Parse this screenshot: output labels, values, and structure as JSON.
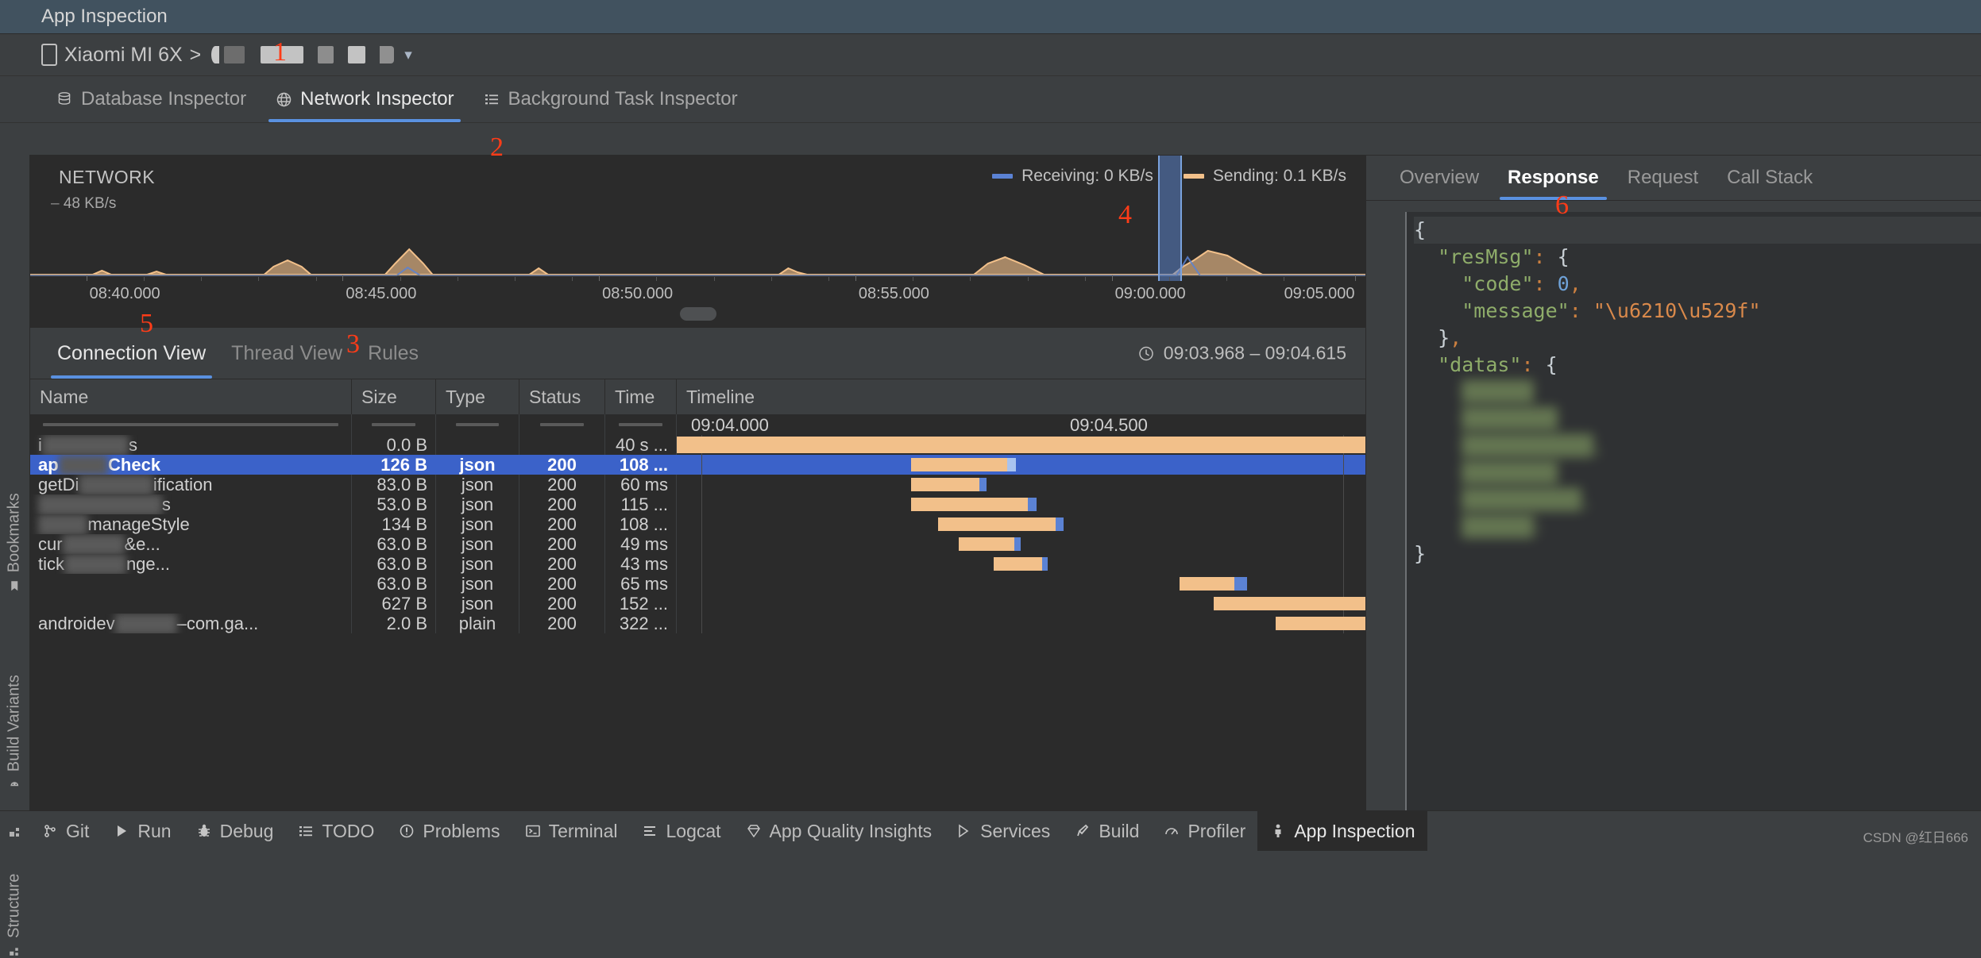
{
  "window": {
    "title": "App Inspection"
  },
  "device_bar": {
    "device": "Xiaomi MI 6X",
    "separator": ">",
    "process_redacted": "█████████",
    "dropdown_icon": "chevron-down-icon",
    "annotation": "1"
  },
  "inspector_tabs": [
    {
      "label": "Database Inspector",
      "icon": "database-icon",
      "selected": false
    },
    {
      "label": "Network Inspector",
      "icon": "globe-icon",
      "selected": true,
      "annotation": "2"
    },
    {
      "label": "Background Task Inspector",
      "icon": "list-icon",
      "selected": false
    }
  ],
  "network_graph": {
    "title": "NETWORK",
    "y_axis_label": "48 KB/s",
    "legend": [
      {
        "label": "Receiving: 0 KB/s",
        "color": "#5b82d4"
      },
      {
        "label": "Sending: 0.1 KB/s",
        "color": "#f2c08a"
      }
    ],
    "annotation": "4",
    "x_ticks": [
      "08:40.000",
      "08:45.000",
      "08:50.000",
      "08:55.000",
      "09:00.000",
      "09:05.000"
    ]
  },
  "connection_tabs": [
    {
      "label": "Connection View",
      "selected": true,
      "annotation": "5"
    },
    {
      "label": "Thread View",
      "selected": false
    },
    {
      "label": "Rules",
      "selected": false,
      "annotation": "3"
    }
  ],
  "time_range": {
    "icon": "clock-icon",
    "text": "09:03.968 – 09:04.615"
  },
  "table": {
    "columns": [
      "Name",
      "Size",
      "Type",
      "Status",
      "Time",
      "Timeline"
    ],
    "timeline_ticks": [
      "09:04.000",
      "09:04.500"
    ],
    "rows": [
      {
        "name": "i███████s",
        "size": "0.0 B",
        "type": "",
        "status": "",
        "time": "40 s ...",
        "selected": false
      },
      {
        "name": "ap████Check",
        "size": "126 B",
        "type": "json",
        "status": "200",
        "time": "108 ...",
        "selected": true
      },
      {
        "name": "getDi██████ification",
        "size": "83.0 B",
        "type": "json",
        "status": "200",
        "time": "60 ms",
        "selected": false
      },
      {
        "name": "██████████s",
        "size": "53.0 B",
        "type": "json",
        "status": "200",
        "time": "115 ...",
        "selected": false
      },
      {
        "name": "████manageStyle",
        "size": "134 B",
        "type": "json",
        "status": "200",
        "time": "108 ...",
        "selected": false
      },
      {
        "name": "cur█████&e...",
        "size": "63.0 B",
        "type": "json",
        "status": "200",
        "time": "49 ms",
        "selected": false
      },
      {
        "name": "tick█████nge...",
        "size": "63.0 B",
        "type": "json",
        "status": "200",
        "time": "43 ms",
        "selected": false
      },
      {
        "name": "",
        "size": "63.0 B",
        "type": "json",
        "status": "200",
        "time": "65 ms",
        "selected": false
      },
      {
        "name": "",
        "size": "627 B",
        "type": "json",
        "status": "200",
        "time": "152 ...",
        "selected": false
      },
      {
        "name": "androidev█████–com.ga...",
        "size": "2.0 B",
        "type": "plain",
        "status": "200",
        "time": "322 ...",
        "selected": false
      }
    ]
  },
  "detail_tabs": [
    {
      "label": "Overview",
      "selected": false
    },
    {
      "label": "Response",
      "selected": true,
      "annotation": "6"
    },
    {
      "label": "Request",
      "selected": false
    },
    {
      "label": "Call Stack",
      "selected": false
    }
  ],
  "response_body": {
    "lines": [
      {
        "indent": 0,
        "tokens": [
          {
            "t": "{",
            "c": "punc"
          }
        ],
        "highlight": true
      },
      {
        "indent": 1,
        "tokens": [
          {
            "t": "\"resMsg\"",
            "c": "key"
          },
          {
            "t": ":",
            "c": "colon"
          },
          {
            "t": " ",
            "c": "punc"
          },
          {
            "t": "{",
            "c": "punc"
          }
        ]
      },
      {
        "indent": 2,
        "tokens": [
          {
            "t": "\"code\"",
            "c": "key"
          },
          {
            "t": ":",
            "c": "colon"
          },
          {
            "t": " ",
            "c": "punc"
          },
          {
            "t": "0",
            "c": "num"
          },
          {
            "t": ",",
            "c": "comma"
          }
        ]
      },
      {
        "indent": 2,
        "tokens": [
          {
            "t": "\"message\"",
            "c": "key"
          },
          {
            "t": ":",
            "c": "colon"
          },
          {
            "t": " ",
            "c": "punc"
          },
          {
            "t": "\"\\u6210\\u529f\"",
            "c": "str"
          }
        ]
      },
      {
        "indent": 1,
        "tokens": [
          {
            "t": "}",
            "c": "punc"
          },
          {
            "t": ",",
            "c": "comma"
          }
        ]
      },
      {
        "indent": 1,
        "tokens": [
          {
            "t": "\"datas\"",
            "c": "key"
          },
          {
            "t": ":",
            "c": "colon"
          },
          {
            "t": " ",
            "c": "punc"
          },
          {
            "t": "{",
            "c": "punc"
          }
        ]
      },
      {
        "indent": 2,
        "tokens": [
          {
            "t": "██████",
            "c": "key"
          }
        ]
      },
      {
        "indent": 2,
        "tokens": [
          {
            "t": "████████",
            "c": "key"
          }
        ]
      },
      {
        "indent": 2,
        "tokens": [
          {
            "t": "███████████,",
            "c": "key"
          }
        ]
      },
      {
        "indent": 2,
        "tokens": [
          {
            "t": "████████",
            "c": "key"
          }
        ]
      },
      {
        "indent": 2,
        "tokens": [
          {
            "t": "██████████,",
            "c": "key"
          }
        ]
      },
      {
        "indent": 2,
        "tokens": [
          {
            "t": "██████:",
            "c": "key"
          }
        ]
      },
      {
        "indent": 0,
        "tokens": [
          {
            "t": "}",
            "c": "punc"
          }
        ]
      }
    ]
  },
  "left_toolbar": [
    {
      "label": "Bookmarks",
      "icon": "bookmark-icon"
    },
    {
      "label": "Build Variants",
      "icon": "android-icon"
    },
    {
      "label": "Structure",
      "icon": "structure-icon"
    }
  ],
  "status_bar": {
    "items": [
      {
        "label": "Git",
        "icon": "git-icon",
        "active": false
      },
      {
        "label": "Run",
        "icon": "play-icon",
        "active": false
      },
      {
        "label": "Debug",
        "icon": "bug-icon",
        "active": false
      },
      {
        "label": "TODO",
        "icon": "todo-list-icon",
        "active": false
      },
      {
        "label": "Problems",
        "icon": "problems-icon",
        "active": false
      },
      {
        "label": "Terminal",
        "icon": "terminal-icon",
        "active": false
      },
      {
        "label": "Logcat",
        "icon": "logcat-icon",
        "active": false
      },
      {
        "label": "App Quality Insights",
        "icon": "diamond-icon",
        "active": false
      },
      {
        "label": "Services",
        "icon": "services-icon",
        "active": false
      },
      {
        "label": "Build",
        "icon": "hammer-icon",
        "active": false
      },
      {
        "label": "Profiler",
        "icon": "profiler-icon",
        "active": false
      },
      {
        "label": "App Inspection",
        "icon": "app-inspection-icon",
        "active": true
      }
    ],
    "watermark": "CSDN @红日666"
  },
  "colors": {
    "accent_blue": "#5a91e0",
    "selection_blue": "#3b62c9",
    "sending_orange": "#f2c08a",
    "receiving_blue": "#5b82d4",
    "annotation_red": "#ff3c18",
    "panel_bg": "#3c3f41",
    "content_bg": "#2b2b2b"
  }
}
